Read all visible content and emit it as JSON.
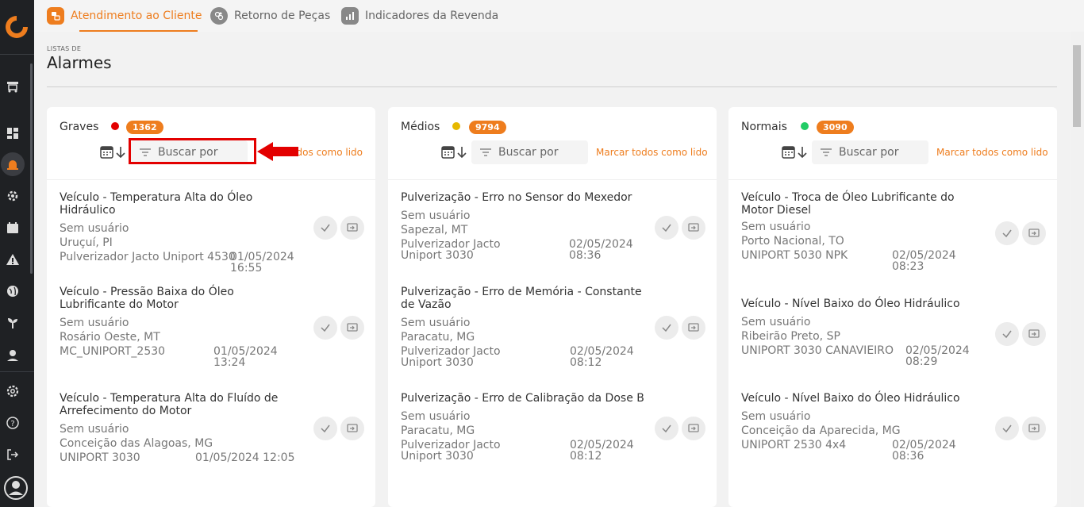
{
  "tabs": [
    {
      "label": "Atendimento ao Cliente",
      "active": true
    },
    {
      "label": "Retorno de Peças",
      "active": false
    },
    {
      "label": "Indicadores da Revenda",
      "active": false
    }
  ],
  "page": {
    "crumb": "LISTAS DE",
    "title": "Alarmes"
  },
  "colors": {
    "accent": "#ee7d1e",
    "grave": "#e30000",
    "medio": "#e6b800",
    "normal": "#22cc66"
  },
  "columns": [
    {
      "title": "Graves",
      "count": "1362",
      "search_placeholder": "Buscar por",
      "mark_all": "Marcar todos como lido",
      "items": [
        {
          "title": "Veículo - Temperatura Alta do Óleo Hidráulico",
          "user": "Sem usuário",
          "location": "Uruçuí, PI",
          "equipment": "Pulverizador Jacto Uniport 4530",
          "date": "01/05/2024 16:55"
        },
        {
          "title": "Veículo - Pressão Baixa do Óleo Lubrificante do Motor",
          "user": "Sem usuário",
          "location": "Rosário Oeste, MT",
          "equipment": "MC_UNIPORT_2530",
          "date": "01/05/2024 13:24"
        },
        {
          "title": "Veículo - Temperatura Alta do Fluído de Arrefecimento do Motor",
          "user": "Sem usuário",
          "location": "Conceição das Alagoas, MG",
          "equipment": "UNIPORT 3030",
          "date": "01/05/2024 12:05"
        }
      ]
    },
    {
      "title": "Médios",
      "count": "9794",
      "search_placeholder": "Buscar por",
      "mark_all": "Marcar todos como lido",
      "items": [
        {
          "title": "Pulverização - Erro no Sensor do Mexedor",
          "user": "Sem usuário",
          "location": "Sapezal, MT",
          "equipment": "Pulverizador Jacto Uniport 3030",
          "date": "02/05/2024 08:36"
        },
        {
          "title": "Pulverização - Erro de Memória - Constante de Vazão",
          "user": "Sem usuário",
          "location": "Paracatu, MG",
          "equipment": "Pulverizador Jacto Uniport 3030",
          "date": "02/05/2024 08:12"
        },
        {
          "title": "Pulverização - Erro de Calibração da Dose B",
          "user": "Sem usuário",
          "location": "Paracatu, MG",
          "equipment": "Pulverizador Jacto Uniport 3030",
          "date": "02/05/2024 08:12"
        }
      ]
    },
    {
      "title": "Normais",
      "count": "3090",
      "search_placeholder": "Buscar por",
      "mark_all": "Marcar todos como lido",
      "items": [
        {
          "title": "Veículo - Troca de Óleo Lubrificante do Motor Diesel",
          "user": "Sem usuário",
          "location": "Porto Nacional, TO",
          "equipment": "UNIPORT 5030 NPK",
          "date": "02/05/2024 08:23"
        },
        {
          "title": "Veículo - Nível Baixo do Óleo Hidráulico",
          "user": "Sem usuário",
          "location": "Ribeirão Preto, SP",
          "equipment": "UNIPORT 3030 CANAVIEIRO",
          "date": "02/05/2024 08:29"
        },
        {
          "title": "Veículo - Nível Baixo do Óleo Hidráulico",
          "user": "Sem usuário",
          "location": "Conceição da Aparecida, MG",
          "equipment": "UNIPORT 2530 4x4",
          "date": "02/05/2024 08:36"
        }
      ]
    }
  ],
  "sidebar_icons": [
    "logo-icon",
    "tractor-icon",
    "dashboard-icon",
    "alarm-icon",
    "gears-icon",
    "calendar-icon",
    "warning-icon",
    "globe-icon",
    "plant-icon",
    "location-icon",
    "settings-icon",
    "help-icon",
    "logout-icon",
    "user-icon"
  ]
}
